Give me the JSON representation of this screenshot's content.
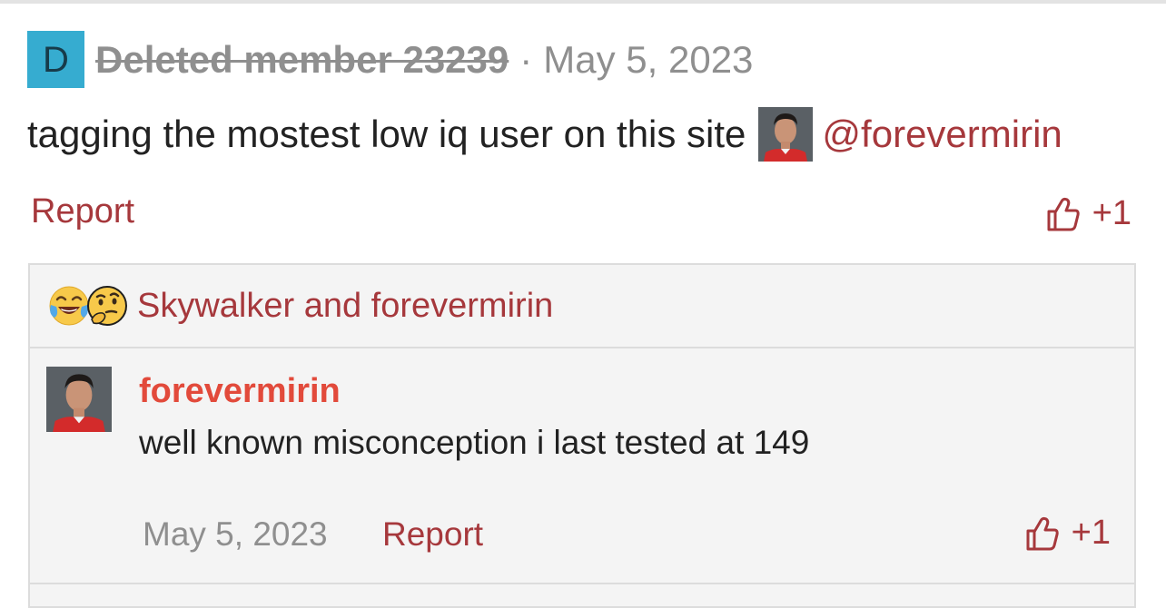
{
  "post": {
    "author": {
      "avatar_letter": "D",
      "name": "Deleted member 23239",
      "avatar_color": "#36acd0"
    },
    "separator": "·",
    "date": "May 5, 2023",
    "body": {
      "text": "tagging the mostest low iq user on this site",
      "mention": "@forevermirin"
    },
    "report_label": "Report",
    "like_count": "+1"
  },
  "reactions": {
    "emojis": [
      "face-with-tears-of-joy",
      "thinking-face"
    ],
    "users_text": "Skywalker and forevermirin"
  },
  "reply": {
    "author": "forevermirin",
    "text": "well known misconception i last tested at 149",
    "date": "May 5, 2023",
    "report_label": "Report",
    "like_count": "+1"
  },
  "colors": {
    "link": "#a6383c",
    "muted": "#8f8f8f",
    "reply_author": "#e24a3b",
    "box_bg": "#f4f4f4"
  }
}
